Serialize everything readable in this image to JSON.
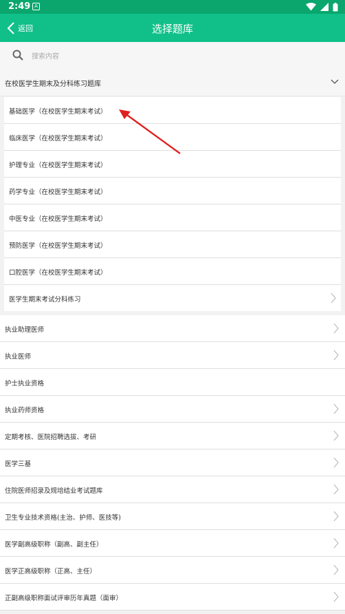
{
  "status_bar": {
    "time": "2:49",
    "notif": "A"
  },
  "header": {
    "back_label": "返回",
    "title": "选择题库"
  },
  "search": {
    "placeholder": "搜索内容"
  },
  "group": {
    "label": "在校医学生期末及分科练习题库"
  },
  "sub_items": [
    "基础医学（在校医学生期末考试）",
    "临床医学（在校医学生期末考试）",
    "护理专业（在校医学生期末考试）",
    "药学专业（在校医学生期末考试）",
    "中医专业（在校医学生期末考试）",
    "预防医学（在校医学生期末考试）",
    "口腔医学（在校医学生期末考试）",
    "医学生期末考试分科练习"
  ],
  "items": [
    "执业助理医师",
    "执业医师",
    "护士执业资格",
    "执业药师资格",
    "定期考核、医院招聘选拔、考研",
    "医学三基",
    "住院医师招录及规培结业考试题库",
    "卫生专业技术资格(主治、护师、医技等)",
    "医学副高级职称（副高、副主任）",
    "医学正高级职称（正高、主任）",
    "正副高级职称面试评审历年真题（面审）"
  ],
  "colors": {
    "status_bar": "#0aa66e",
    "header": "#10c088",
    "annotation_arrow": "#e02020"
  }
}
